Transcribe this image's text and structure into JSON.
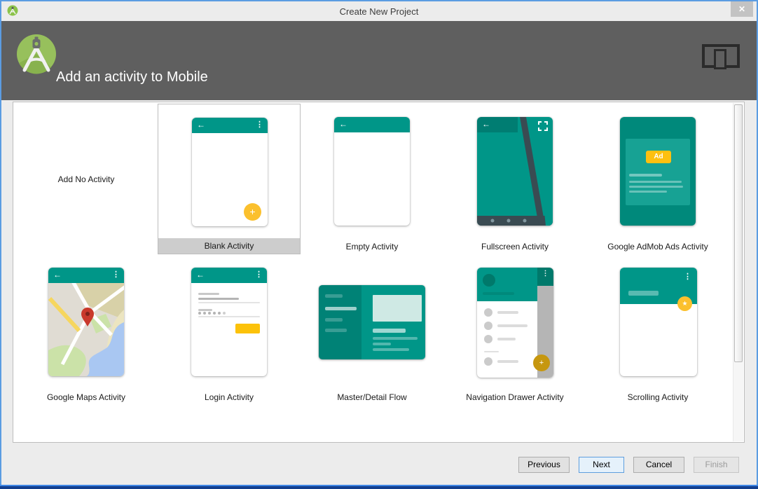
{
  "window": {
    "title": "Create New Project"
  },
  "header": {
    "title": "Add an activity to Mobile"
  },
  "icons": {
    "back": "←",
    "menu": "⋮",
    "plus": "+",
    "star": "★",
    "close": "✕"
  },
  "grid": {
    "items": [
      {
        "label": "Add No Activity",
        "selected": false
      },
      {
        "label": "Blank Activity",
        "selected": true
      },
      {
        "label": "Empty Activity",
        "selected": false
      },
      {
        "label": "Fullscreen Activity",
        "selected": false
      },
      {
        "label": "Google AdMob Ads Activity",
        "selected": false,
        "ad_badge": "Ad"
      },
      {
        "label": "Google Maps Activity",
        "selected": false
      },
      {
        "label": "Login Activity",
        "selected": false
      },
      {
        "label": "Master/Detail Flow",
        "selected": false
      },
      {
        "label": "Navigation Drawer Activity",
        "selected": false
      },
      {
        "label": "Scrolling Activity",
        "selected": false
      }
    ]
  },
  "footer": {
    "buttons": [
      {
        "label": "Previous",
        "enabled": true,
        "default": false
      },
      {
        "label": "Next",
        "enabled": true,
        "default": true
      },
      {
        "label": "Cancel",
        "enabled": true,
        "default": false
      },
      {
        "label": "Finish",
        "enabled": false,
        "default": false
      }
    ]
  },
  "colors": {
    "teal": "#009688",
    "teal_dark": "#00897b",
    "amber": "#fbc02d",
    "header_bg": "#5f5f5f",
    "selected_label_bg": "#cdcdcd",
    "window_border": "#5b9ce2"
  }
}
